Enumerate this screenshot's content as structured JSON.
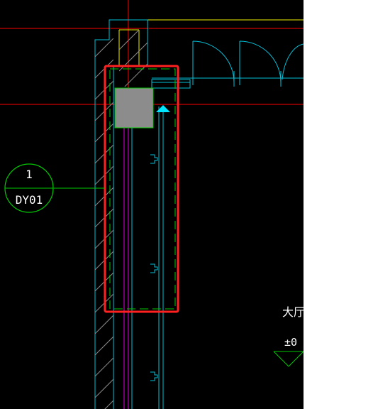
{
  "canvas": {
    "background": "#000000",
    "colors": {
      "red_line": "#ff0000",
      "selection": "#ff2020",
      "cyan": "#00bfd8",
      "bright_cyan": "#00e5ff",
      "green": "#00c800",
      "yellow": "#f0f000",
      "magenta": "#e000e0",
      "grey_hatch": "#8a8a8a",
      "fill_grey": "#8c8c8c"
    }
  },
  "elevator_tag": {
    "number": "1",
    "code": "DY01",
    "icon": "circle-tag-icon"
  },
  "annotations": {
    "room_label": "大厅",
    "elevation_label": "±0",
    "elevation_icon": "elevation-marker-icon"
  },
  "selection": {
    "icon": "grip-triangle-icon"
  },
  "blank_panel": {
    "background": "#ffffff"
  }
}
